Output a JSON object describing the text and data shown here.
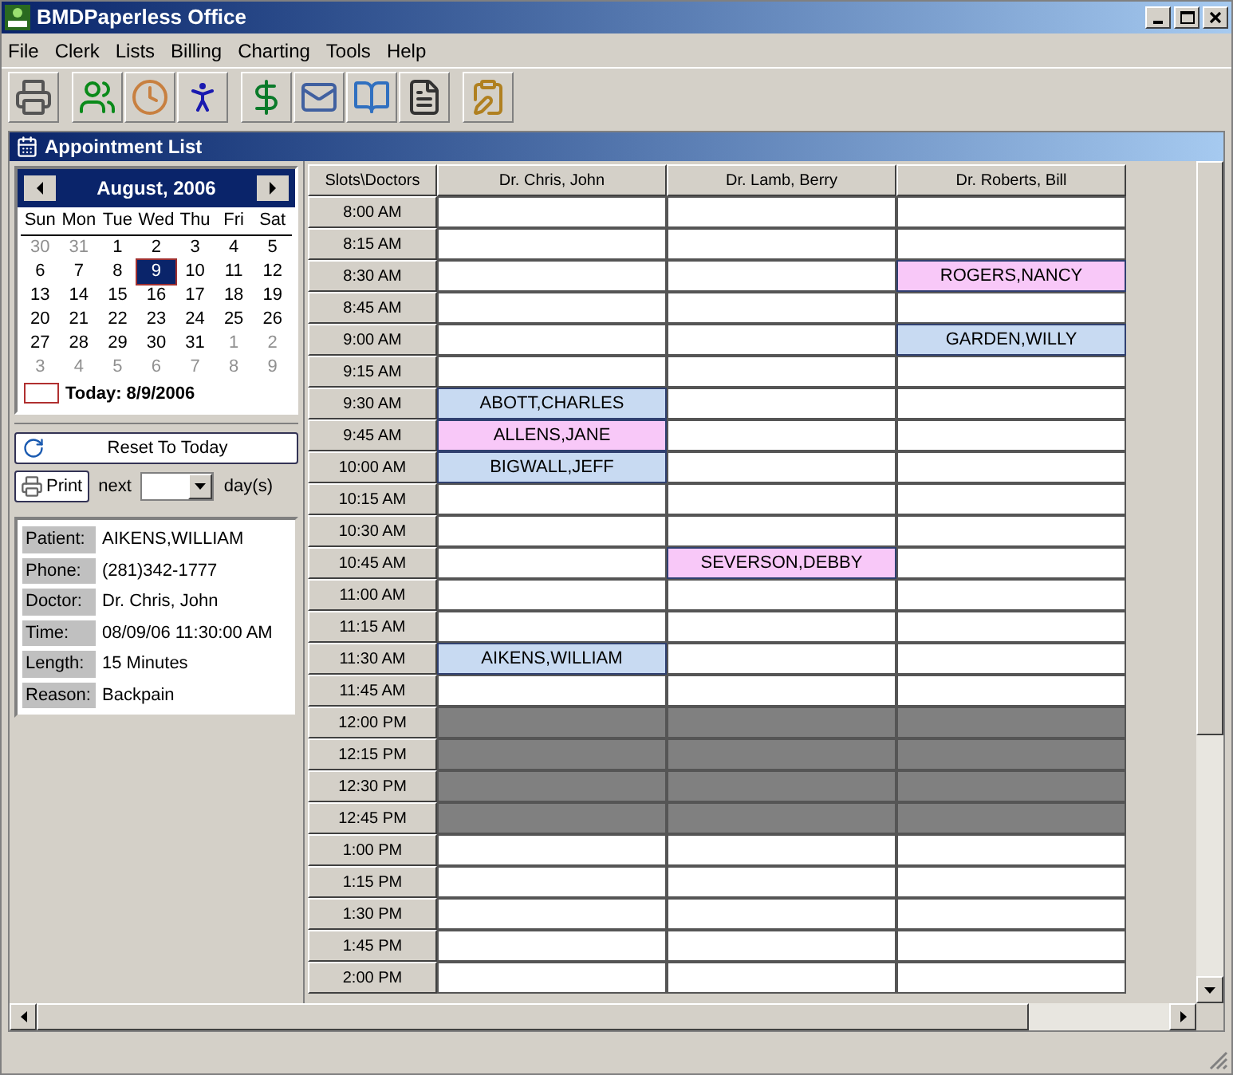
{
  "window": {
    "title": "BMDPaperless Office"
  },
  "menu": [
    "File",
    "Clerk",
    "Lists",
    "Billing",
    "Charting",
    "Tools",
    "Help"
  ],
  "child_window": {
    "title": "Appointment List"
  },
  "calendar": {
    "month": "August, 2006",
    "weekdays": [
      "Sun",
      "Mon",
      "Tue",
      "Wed",
      "Thu",
      "Fri",
      "Sat"
    ],
    "weeks": [
      [
        {
          "day": "30",
          "other_month": true,
          "selected": false
        },
        {
          "day": "31",
          "other_month": true,
          "selected": false
        },
        {
          "day": "1",
          "other_month": false,
          "selected": false
        },
        {
          "day": "2",
          "other_month": false,
          "selected": false
        },
        {
          "day": "3",
          "other_month": false,
          "selected": false
        },
        {
          "day": "4",
          "other_month": false,
          "selected": false
        },
        {
          "day": "5",
          "other_month": false,
          "selected": false
        }
      ],
      [
        {
          "day": "6",
          "other_month": false,
          "selected": false
        },
        {
          "day": "7",
          "other_month": false,
          "selected": false
        },
        {
          "day": "8",
          "other_month": false,
          "selected": false
        },
        {
          "day": "9",
          "other_month": false,
          "selected": true
        },
        {
          "day": "10",
          "other_month": false,
          "selected": false
        },
        {
          "day": "11",
          "other_month": false,
          "selected": false
        },
        {
          "day": "12",
          "other_month": false,
          "selected": false
        }
      ],
      [
        {
          "day": "13",
          "other_month": false,
          "selected": false
        },
        {
          "day": "14",
          "other_month": false,
          "selected": false
        },
        {
          "day": "15",
          "other_month": false,
          "selected": false
        },
        {
          "day": "16",
          "other_month": false,
          "selected": false
        },
        {
          "day": "17",
          "other_month": false,
          "selected": false
        },
        {
          "day": "18",
          "other_month": false,
          "selected": false
        },
        {
          "day": "19",
          "other_month": false,
          "selected": false
        }
      ],
      [
        {
          "day": "20",
          "other_month": false,
          "selected": false
        },
        {
          "day": "21",
          "other_month": false,
          "selected": false
        },
        {
          "day": "22",
          "other_month": false,
          "selected": false
        },
        {
          "day": "23",
          "other_month": false,
          "selected": false
        },
        {
          "day": "24",
          "other_month": false,
          "selected": false
        },
        {
          "day": "25",
          "other_month": false,
          "selected": false
        },
        {
          "day": "26",
          "other_month": false,
          "selected": false
        }
      ],
      [
        {
          "day": "27",
          "other_month": false,
          "selected": false
        },
        {
          "day": "28",
          "other_month": false,
          "selected": false
        },
        {
          "day": "29",
          "other_month": false,
          "selected": false
        },
        {
          "day": "30",
          "other_month": false,
          "selected": false
        },
        {
          "day": "31",
          "other_month": false,
          "selected": false
        },
        {
          "day": "1",
          "other_month": true,
          "selected": false
        },
        {
          "day": "2",
          "other_month": true,
          "selected": false
        }
      ],
      [
        {
          "day": "3",
          "other_month": true,
          "selected": false
        },
        {
          "day": "4",
          "other_month": true,
          "selected": false
        },
        {
          "day": "5",
          "other_month": true,
          "selected": false
        },
        {
          "day": "6",
          "other_month": true,
          "selected": false
        },
        {
          "day": "7",
          "other_month": true,
          "selected": false
        },
        {
          "day": "8",
          "other_month": true,
          "selected": false
        },
        {
          "day": "9",
          "other_month": true,
          "selected": false
        }
      ]
    ],
    "today": "Today: 8/9/2006"
  },
  "controls": {
    "reset_button": "Reset To Today",
    "print_button": "Print",
    "next_label": "next",
    "days_label": "day(s)"
  },
  "details": [
    {
      "label": "Patient:",
      "value": "AIKENS,WILLIAM"
    },
    {
      "label": "Phone:",
      "value": "(281)342-1777"
    },
    {
      "label": "Doctor:",
      "value": "Dr. Chris, John"
    },
    {
      "label": "Time:",
      "value": "08/09/06 11:30:00 AM"
    },
    {
      "label": "Length:",
      "value": "15 Minutes"
    },
    {
      "label": "Reason:",
      "value": "Backpain"
    }
  ],
  "schedule": {
    "corner": "Slots\\Doctors",
    "doctors": [
      "Dr. Chris, John",
      "Dr. Lamb, Berry",
      "Dr. Roberts, Bill"
    ],
    "rows": [
      {
        "time": "8:00 AM",
        "cells": [
          {
            "kind": "empty"
          },
          {
            "kind": "empty"
          },
          {
            "kind": "empty"
          }
        ]
      },
      {
        "time": "8:15 AM",
        "cells": [
          {
            "kind": "empty"
          },
          {
            "kind": "empty"
          },
          {
            "kind": "empty"
          }
        ]
      },
      {
        "time": "8:30 AM",
        "cells": [
          {
            "kind": "empty"
          },
          {
            "kind": "empty"
          },
          {
            "kind": "appointment",
            "patient": "ROGERS,NANCY",
            "color": "#f8c8f8"
          }
        ]
      },
      {
        "time": "8:45 AM",
        "cells": [
          {
            "kind": "empty"
          },
          {
            "kind": "empty"
          },
          {
            "kind": "empty"
          }
        ]
      },
      {
        "time": "9:00 AM",
        "cells": [
          {
            "kind": "empty"
          },
          {
            "kind": "empty"
          },
          {
            "kind": "appointment",
            "patient": "GARDEN,WILLY",
            "color": "#c8daf2"
          }
        ]
      },
      {
        "time": "9:15 AM",
        "cells": [
          {
            "kind": "empty"
          },
          {
            "kind": "empty"
          },
          {
            "kind": "empty"
          }
        ]
      },
      {
        "time": "9:30 AM",
        "cells": [
          {
            "kind": "appointment",
            "patient": "ABOTT,CHARLES",
            "color": "#c8daf2"
          },
          {
            "kind": "empty"
          },
          {
            "kind": "empty"
          }
        ]
      },
      {
        "time": "9:45 AM",
        "cells": [
          {
            "kind": "appointment",
            "patient": "ALLENS,JANE",
            "color": "#f8c8f8"
          },
          {
            "kind": "empty"
          },
          {
            "kind": "empty"
          }
        ]
      },
      {
        "time": "10:00 AM",
        "cells": [
          {
            "kind": "appointment",
            "patient": "BIGWALL,JEFF",
            "color": "#c8daf2"
          },
          {
            "kind": "empty"
          },
          {
            "kind": "empty"
          }
        ]
      },
      {
        "time": "10:15 AM",
        "cells": [
          {
            "kind": "empty"
          },
          {
            "kind": "empty"
          },
          {
            "kind": "empty"
          }
        ]
      },
      {
        "time": "10:30 AM",
        "cells": [
          {
            "kind": "empty"
          },
          {
            "kind": "empty"
          },
          {
            "kind": "empty"
          }
        ]
      },
      {
        "time": "10:45 AM",
        "cells": [
          {
            "kind": "empty"
          },
          {
            "kind": "appointment",
            "patient": "SEVERSON,DEBBY",
            "color": "#f8c8f8"
          },
          {
            "kind": "empty"
          }
        ]
      },
      {
        "time": "11:00 AM",
        "cells": [
          {
            "kind": "empty"
          },
          {
            "kind": "empty"
          },
          {
            "kind": "empty"
          }
        ]
      },
      {
        "time": "11:15 AM",
        "cells": [
          {
            "kind": "empty"
          },
          {
            "kind": "empty"
          },
          {
            "kind": "empty"
          }
        ]
      },
      {
        "time": "11:30 AM",
        "cells": [
          {
            "kind": "appointment",
            "patient": "AIKENS,WILLIAM",
            "color": "#c8daf2"
          },
          {
            "kind": "empty"
          },
          {
            "kind": "empty"
          }
        ]
      },
      {
        "time": "11:45 AM",
        "cells": [
          {
            "kind": "empty"
          },
          {
            "kind": "empty"
          },
          {
            "kind": "empty"
          }
        ]
      },
      {
        "time": "12:00 PM",
        "cells": [
          {
            "kind": "blocked"
          },
          {
            "kind": "blocked"
          },
          {
            "kind": "blocked"
          }
        ]
      },
      {
        "time": "12:15 PM",
        "cells": [
          {
            "kind": "blocked"
          },
          {
            "kind": "blocked"
          },
          {
            "kind": "blocked"
          }
        ]
      },
      {
        "time": "12:30 PM",
        "cells": [
          {
            "kind": "blocked"
          },
          {
            "kind": "blocked"
          },
          {
            "kind": "blocked"
          }
        ]
      },
      {
        "time": "12:45 PM",
        "cells": [
          {
            "kind": "blocked"
          },
          {
            "kind": "blocked"
          },
          {
            "kind": "blocked"
          }
        ]
      },
      {
        "time": "1:00 PM",
        "cells": [
          {
            "kind": "empty"
          },
          {
            "kind": "empty"
          },
          {
            "kind": "empty"
          }
        ]
      },
      {
        "time": "1:15 PM",
        "cells": [
          {
            "kind": "empty"
          },
          {
            "kind": "empty"
          },
          {
            "kind": "empty"
          }
        ]
      },
      {
        "time": "1:30 PM",
        "cells": [
          {
            "kind": "empty"
          },
          {
            "kind": "empty"
          },
          {
            "kind": "empty"
          }
        ]
      },
      {
        "time": "1:45 PM",
        "cells": [
          {
            "kind": "empty"
          },
          {
            "kind": "empty"
          },
          {
            "kind": "empty"
          }
        ]
      },
      {
        "time": "2:00 PM",
        "cells": [
          {
            "kind": "empty"
          },
          {
            "kind": "empty"
          },
          {
            "kind": "empty"
          }
        ]
      }
    ]
  }
}
